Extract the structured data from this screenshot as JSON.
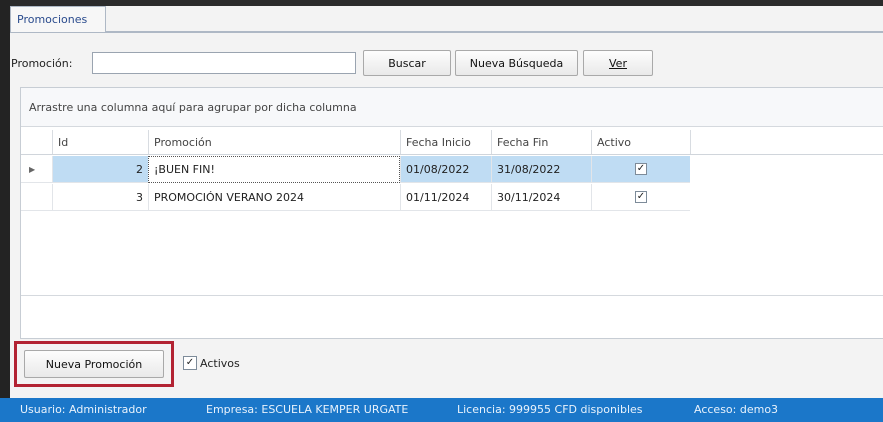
{
  "tabs": [
    {
      "label": "Promociones"
    }
  ],
  "search": {
    "label": "Promoción:",
    "value": "",
    "buscar_label": "Buscar",
    "nueva_busqueda_label": "Nueva Búsqueda",
    "ver_label": "Ver"
  },
  "grid": {
    "group_hint": "Arrastre una columna aquí para agrupar por dicha columna",
    "columns": [
      "Id",
      "Promoción",
      "Fecha Inicio",
      "Fecha Fin",
      "Activo"
    ],
    "rows": [
      {
        "id": "2",
        "promocion": "¡BUEN FIN!",
        "fecha_inicio": "01/08/2022",
        "fecha_fin": "31/08/2022",
        "activo": true,
        "selected": true
      },
      {
        "id": "3",
        "promocion": "PROMOCIÓN VERANO 2024",
        "fecha_inicio": "01/11/2024",
        "fecha_fin": "30/11/2024",
        "activo": true,
        "selected": false
      }
    ],
    "checkmark": "✓"
  },
  "footer": {
    "nueva_promocion_label": "Nueva Promoción",
    "activos_label": "Activos",
    "activos_checked": true
  },
  "status_bar": {
    "usuario": "Usuario: Administrador",
    "empresa": "Empresa: ESCUELA KEMPER URGATE",
    "licencia": "Licencia: 999955 CFD disponibles",
    "acceso": "Acceso: demo3"
  },
  "colors": {
    "accent": "#1b77c9",
    "selection": "#bfdcf3",
    "highlight_box": "#b22232"
  }
}
